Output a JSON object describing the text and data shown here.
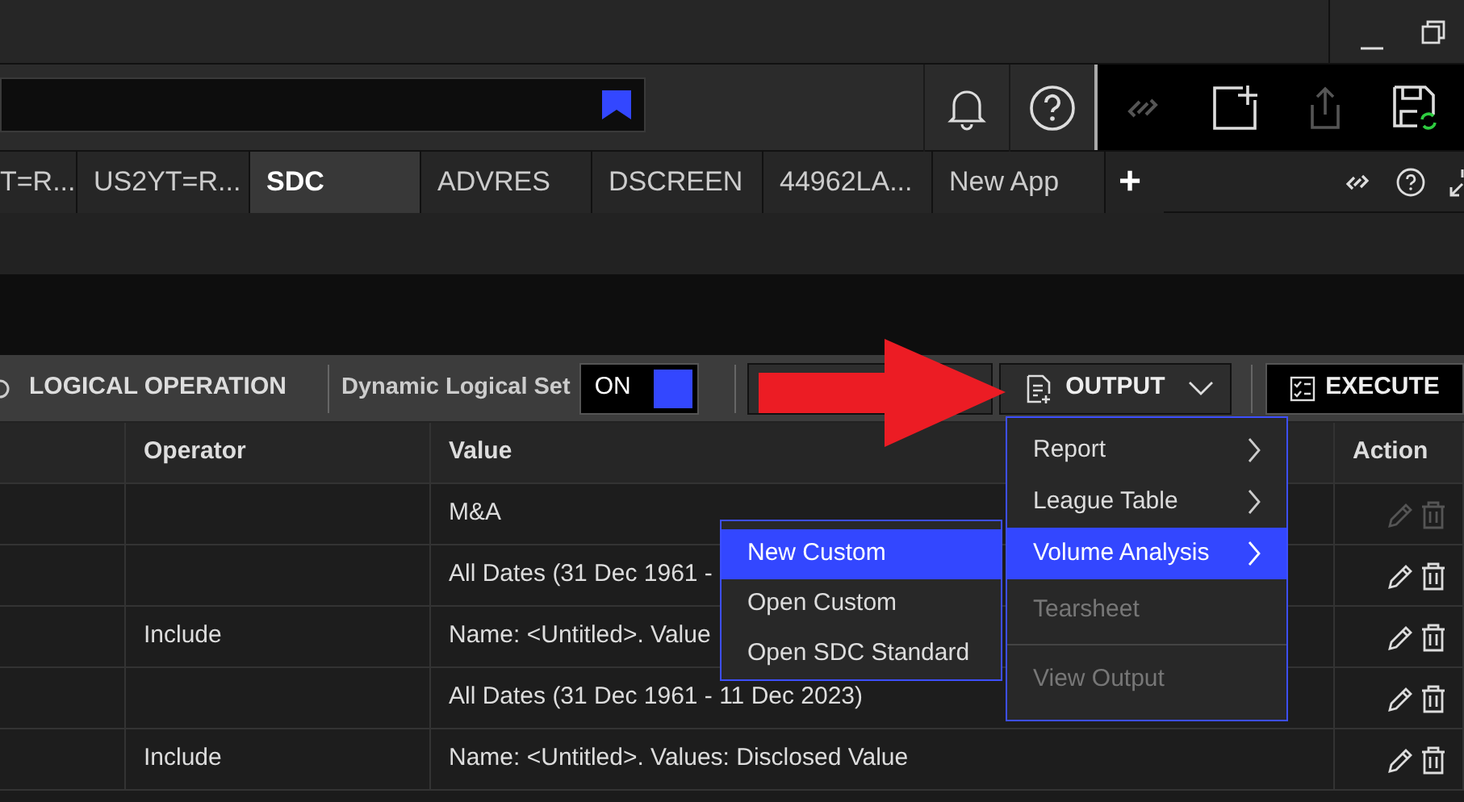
{
  "tabs": [
    {
      "label": "T=R...",
      "selected": false
    },
    {
      "label": "US2YT=R...",
      "selected": false
    },
    {
      "label": "SDC",
      "selected": true
    },
    {
      "label": "ADVRES",
      "selected": false
    },
    {
      "label": "DSCREEN",
      "selected": false
    },
    {
      "label": "44962LA...",
      "selected": false
    },
    {
      "label": "New App",
      "selected": false
    }
  ],
  "add_tab": "+",
  "toolbar": {
    "logical_operation": "LOGICAL OPERATION",
    "dynamic_label": "Dynamic Logical Set",
    "toggle": {
      "label": "ON",
      "on": true
    },
    "output_button": "OUTPUT",
    "execute_button": "EXECUTE"
  },
  "table": {
    "columns": [
      "Operator",
      "Value",
      "Action"
    ],
    "rows": [
      {
        "value": "M&A",
        "actions_enabled": false
      },
      {
        "value": "All Dates (31 Dec 1961 -",
        "actions_enabled": true
      },
      {
        "operator": "Include",
        "value": "Name: <Untitled>. Value",
        "actions_enabled": true
      },
      {
        "value": "All Dates (31 Dec 1961 - 11 Dec 2023)",
        "actions_enabled": true
      },
      {
        "operator": "Include",
        "value": "Name: <Untitled>. Values: Disclosed Value",
        "actions_enabled": true
      }
    ]
  },
  "output_menu": {
    "items": [
      {
        "label": "Report",
        "kind": "submenu",
        "selected": false,
        "disabled": false
      },
      {
        "label": "League Table",
        "kind": "submenu",
        "selected": false,
        "disabled": false
      },
      {
        "label": "Volume Analysis",
        "kind": "submenu",
        "selected": true,
        "disabled": false
      },
      {
        "label": "Tearsheet",
        "kind": "item",
        "selected": false,
        "disabled": true
      },
      {
        "label": "View Output",
        "kind": "item",
        "selected": false,
        "disabled": true,
        "separator_before": true
      }
    ]
  },
  "submenu": {
    "items": [
      {
        "label": "New Custom",
        "selected": true
      },
      {
        "label": "Open Custom",
        "selected": false
      },
      {
        "label": "Open SDC Standard",
        "selected": false
      }
    ]
  }
}
